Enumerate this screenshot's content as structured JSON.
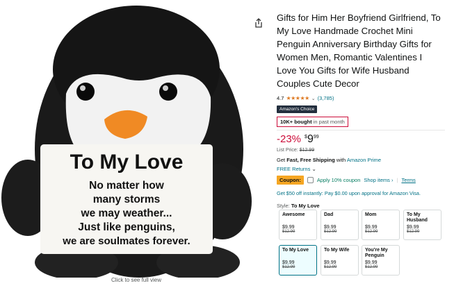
{
  "image": {
    "card_lines": [
      "To My Love",
      "No matter how",
      "many storms",
      "we may weather...",
      "Just like penguins,",
      "we are soulmates forever."
    ],
    "click_to_see": "Click to see full view"
  },
  "product": {
    "title": "Gifts for Him Her Boyfriend Girlfriend, To My Love Handmade Crochet Mini Penguin Anniversary Birthday Gifts for Women Men, Romantic Valentines I Love You Gifts for Wife Husband Couples Cute Decor",
    "rating": "4.7",
    "stars": "★★★★★",
    "ratings_count": "(3,785)",
    "badge": "Amazon's Choice",
    "bought_bold": "10K+ bought",
    "bought_rest": " in past month",
    "discount": "-23%",
    "price_symbol": "$",
    "price_whole": "9",
    "price_fraction": "99",
    "list_price_label": "List Price:",
    "list_price": "$12.99",
    "shipping_pre": "Get ",
    "shipping_bold": "Fast, Free Shipping",
    "shipping_mid": " with ",
    "shipping_link": "Amazon Prime",
    "returns": "FREE Returns",
    "coupon_label": "Coupon:",
    "coupon_text": "Apply 10% coupon",
    "shop_items": "Shop items ›",
    "terms": "Terms",
    "visa_offer": "Get $50 off instantly: Pay $0.00 upon approval for Amazon Visa.",
    "style_label": "Style:",
    "style_value": "To My Love"
  },
  "styles": [
    {
      "name": "Awesome",
      "price": "$9.99",
      "list": "$12.99"
    },
    {
      "name": "Dad",
      "price": "$9.99",
      "list": "$12.99"
    },
    {
      "name": "Mom",
      "price": "$9.99",
      "list": "$12.99"
    },
    {
      "name": "To My Husband",
      "price": "$9.99",
      "list": "$12.99"
    },
    {
      "name": "To My Love",
      "price": "$9.99",
      "list": "$12.99"
    },
    {
      "name": "To My Wife",
      "price": "$9.99",
      "list": "$12.99"
    },
    {
      "name": "You're My Penguin",
      "price": "$9.99",
      "list": "$12.99"
    }
  ],
  "colors": {
    "link": "#007185",
    "deal_red": "#cc0c39",
    "coupon_orange": "#f5a623",
    "star": "#de7921"
  }
}
